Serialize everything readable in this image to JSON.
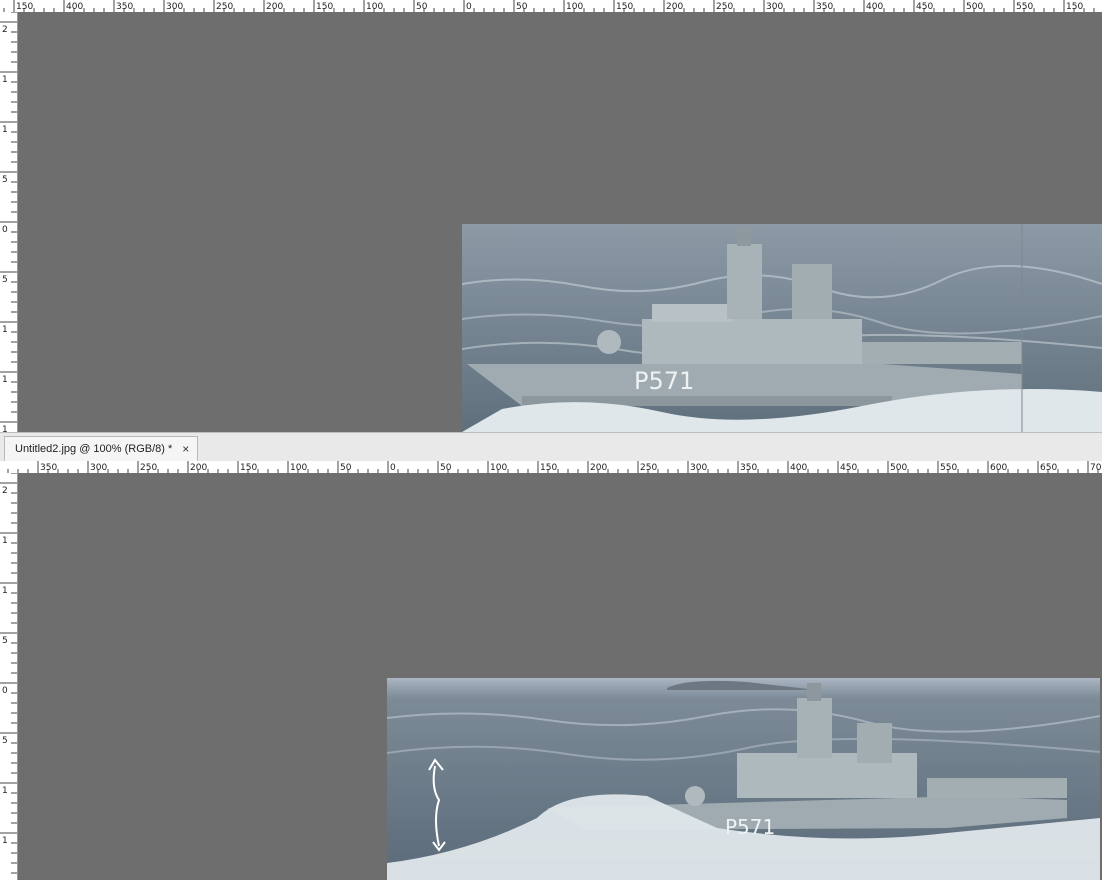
{
  "top_pane": {
    "h_ruler_labels": [
      "150",
      "400",
      "350",
      "300",
      "250",
      "200",
      "150",
      "100",
      "50",
      "0",
      "50",
      "100",
      "150",
      "200",
      "250",
      "300",
      "350",
      "400",
      "450",
      "500",
      "550",
      "150"
    ],
    "v_ruler_labels": [
      "2",
      "1",
      "1",
      "5",
      "0",
      "5",
      "1",
      "1",
      "1"
    ]
  },
  "document_tab": {
    "title": "Untitled2.jpg @ 100% (RGB/8) *",
    "close_glyph": "×"
  },
  "bottom_pane": {
    "h_ruler_labels": [
      "350",
      "300",
      "250",
      "200",
      "150",
      "100",
      "50",
      "0",
      "50",
      "100",
      "150",
      "200",
      "250",
      "300",
      "350",
      "400",
      "450",
      "500",
      "550",
      "600",
      "650",
      "70"
    ],
    "v_ruler_labels": [
      "2",
      "1",
      "1",
      "5",
      "0",
      "5",
      "1",
      "1"
    ]
  },
  "image": {
    "hull_number": "P571",
    "description_colors": {
      "sea": "#6f7f8c",
      "ship": "#a9b5ba",
      "foam": "#e6edf0",
      "sky": "#a6b3bf"
    }
  }
}
